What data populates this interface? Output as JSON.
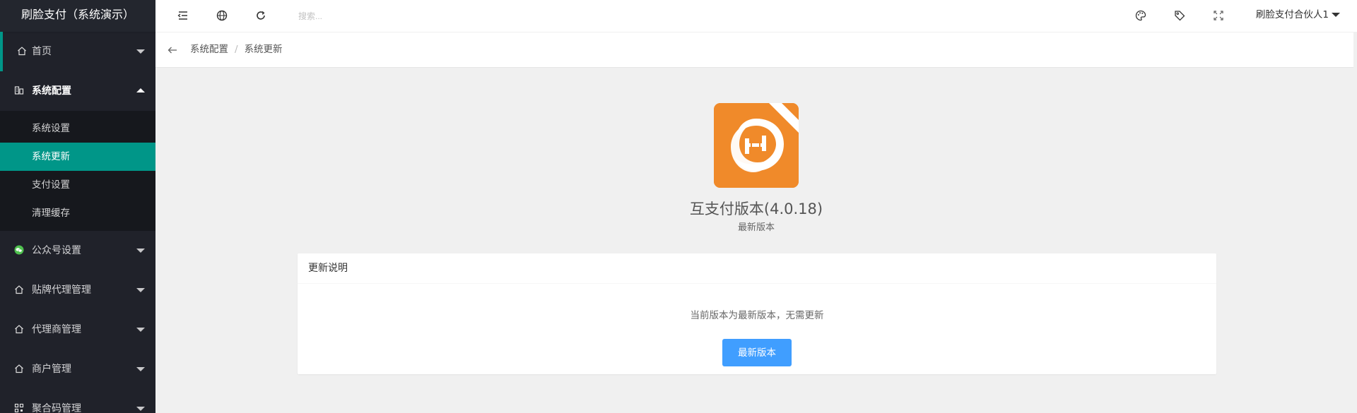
{
  "app": {
    "title": "刷脸支付（系统演示）"
  },
  "sidebar": {
    "items": [
      {
        "label": "首页",
        "icon": "home-icon"
      },
      {
        "label": "系统配置",
        "icon": "settings-icon",
        "open": true,
        "children": [
          {
            "label": "系统设置"
          },
          {
            "label": "系统更新",
            "active": true
          },
          {
            "label": "支付设置"
          },
          {
            "label": "清理缓存"
          }
        ]
      },
      {
        "label": "公众号设置",
        "icon": "wechat-icon"
      },
      {
        "label": "贴牌代理管理",
        "icon": "home-icon"
      },
      {
        "label": "代理商管理",
        "icon": "home-icon"
      },
      {
        "label": "商户管理",
        "icon": "home-icon"
      },
      {
        "label": "聚合码管理",
        "icon": "qrcode-icon"
      }
    ]
  },
  "header": {
    "search_placeholder": "搜索...",
    "user_name": "刷脸支付合伙人1",
    "icons": [
      "menu-shrink-icon",
      "globe-icon",
      "refresh-icon",
      "theme-palette-icon",
      "tag-icon",
      "fullscreen-icon"
    ]
  },
  "breadcrumb": {
    "items": [
      "系统配置",
      "系统更新"
    ]
  },
  "main": {
    "logo_badge": "互支付",
    "version_title": "互支付版本(4.0.18)",
    "version_status": "最新版本",
    "card": {
      "title": "更新说明",
      "message": "当前版本为最新版本，无需更新",
      "button_label": "最新版本"
    }
  },
  "colors": {
    "sidebar_bg": "#20222a",
    "accent": "#009688",
    "button": "#409eff",
    "logo_orange": "#f08a2a"
  }
}
